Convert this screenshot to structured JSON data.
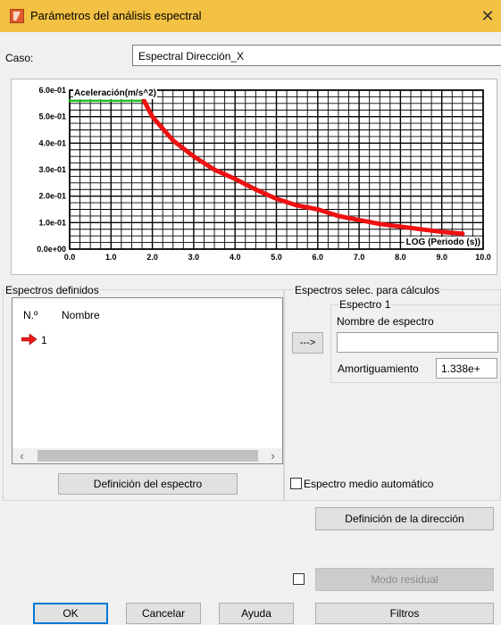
{
  "window": {
    "title": "Parámetros del análisis espectral",
    "close": "✕"
  },
  "caso": {
    "label": "Caso:",
    "value": "Espectral  Dirección_X"
  },
  "chart_data": {
    "type": "line",
    "ylabel": "Aceleración(m/s^2)",
    "xlabel": "LOG (Periodo (s))",
    "xlim": [
      0,
      10
    ],
    "ylim": [
      0,
      0.6
    ],
    "x_ticks": [
      "0.0",
      "1.0",
      "2.0",
      "3.0",
      "4.0",
      "5.0",
      "6.0",
      "7.0",
      "8.0",
      "9.0",
      "10.0"
    ],
    "y_ticks": [
      "0.0e+00",
      "1.0e-01",
      "2.0e-01",
      "3.0e-01",
      "4.0e-01",
      "5.0e-01",
      "6.0e-01"
    ],
    "grid": true,
    "series": [
      {
        "color": "#22c022",
        "x": [
          0.0,
          1.8
        ],
        "y": [
          0.56,
          0.56
        ]
      },
      {
        "color": "#ee1111",
        "x": [
          1.8,
          2.0,
          2.5,
          3.0,
          3.5,
          4.0,
          4.5,
          5.0,
          5.5,
          6.0,
          6.5,
          7.0,
          7.5,
          8.0,
          8.5,
          9.0,
          9.5
        ],
        "y": [
          0.56,
          0.5,
          0.41,
          0.35,
          0.3,
          0.265,
          0.225,
          0.19,
          0.165,
          0.15,
          0.125,
          0.11,
          0.095,
          0.085,
          0.075,
          0.065,
          0.058
        ]
      }
    ]
  },
  "left_group": {
    "title": "Espectros definidos",
    "col_num": "N.º",
    "col_name": "Nombre",
    "rows": [
      {
        "num": "1",
        "icon": "red-arrow-icon"
      }
    ],
    "scroll_left": "‹",
    "scroll_right": "›",
    "button": "Definición del espectro"
  },
  "right_group": {
    "title": "Espectros selec. para cálculos",
    "sub_title": "Espectro 1",
    "name_label": "Nombre de espectro",
    "name_value": "",
    "damping_label": "Amortiguamiento",
    "damping_value": "1.338e+",
    "transfer_button": "--->"
  },
  "auto_spectrum": {
    "label": "Espectro medio automático",
    "checked": false
  },
  "direction_button": "Definición de la dirección",
  "residual": {
    "label": "Modo residual",
    "checked": false
  },
  "buttons": {
    "ok": "OK",
    "cancel": "Cancelar",
    "help": "Ayuda",
    "filters": "Filtros"
  }
}
